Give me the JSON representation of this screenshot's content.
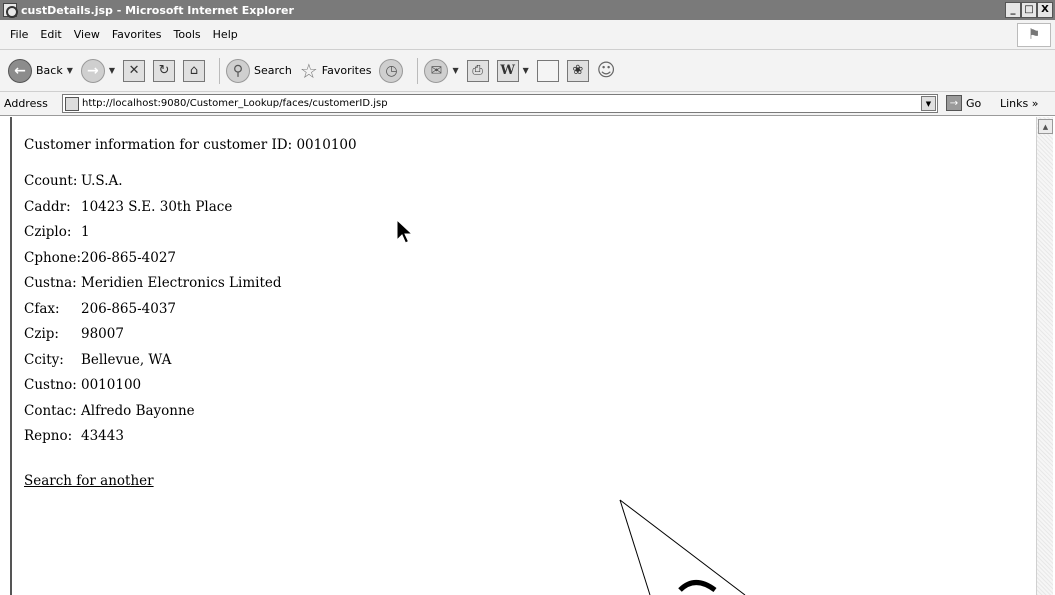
{
  "window": {
    "title": "custDetails.jsp - Microsoft Internet Explorer",
    "controls": {
      "minimize": "_",
      "maximize": "□",
      "close": "X"
    }
  },
  "menu": [
    "File",
    "Edit",
    "View",
    "Favorites",
    "Tools",
    "Help"
  ],
  "toolbar": {
    "back_label": "Back",
    "search_label": "Search",
    "favorites_label": "Favorites"
  },
  "address": {
    "label": "Address",
    "url": "http://localhost:9080/Customer_Lookup/faces/customerID.jsp",
    "go_label": "Go",
    "links_label": "Links »"
  },
  "page": {
    "heading": "Customer information for customer ID: 0010100",
    "fields": [
      {
        "label": "Ccount:",
        "value": "U.S.A."
      },
      {
        "label": "Caddr:",
        "value": "10423 S.E. 30th Place"
      },
      {
        "label": "Cziplo:",
        "value": "1"
      },
      {
        "label": "Cphone:",
        "value": "206-865-4027"
      },
      {
        "label": "Custna:",
        "value": "Meridien Electronics Limited"
      },
      {
        "label": "Cfax:",
        "value": "206-865-4037"
      },
      {
        "label": "Czip:",
        "value": "98007"
      },
      {
        "label": "Ccity:",
        "value": "Bellevue, WA"
      },
      {
        "label": "Custno:",
        "value": "0010100"
      },
      {
        "label": "Contac:",
        "value": "Alfredo Bayonne"
      },
      {
        "label": "Repno:",
        "value": "43443"
      }
    ],
    "link": "Search for another"
  }
}
